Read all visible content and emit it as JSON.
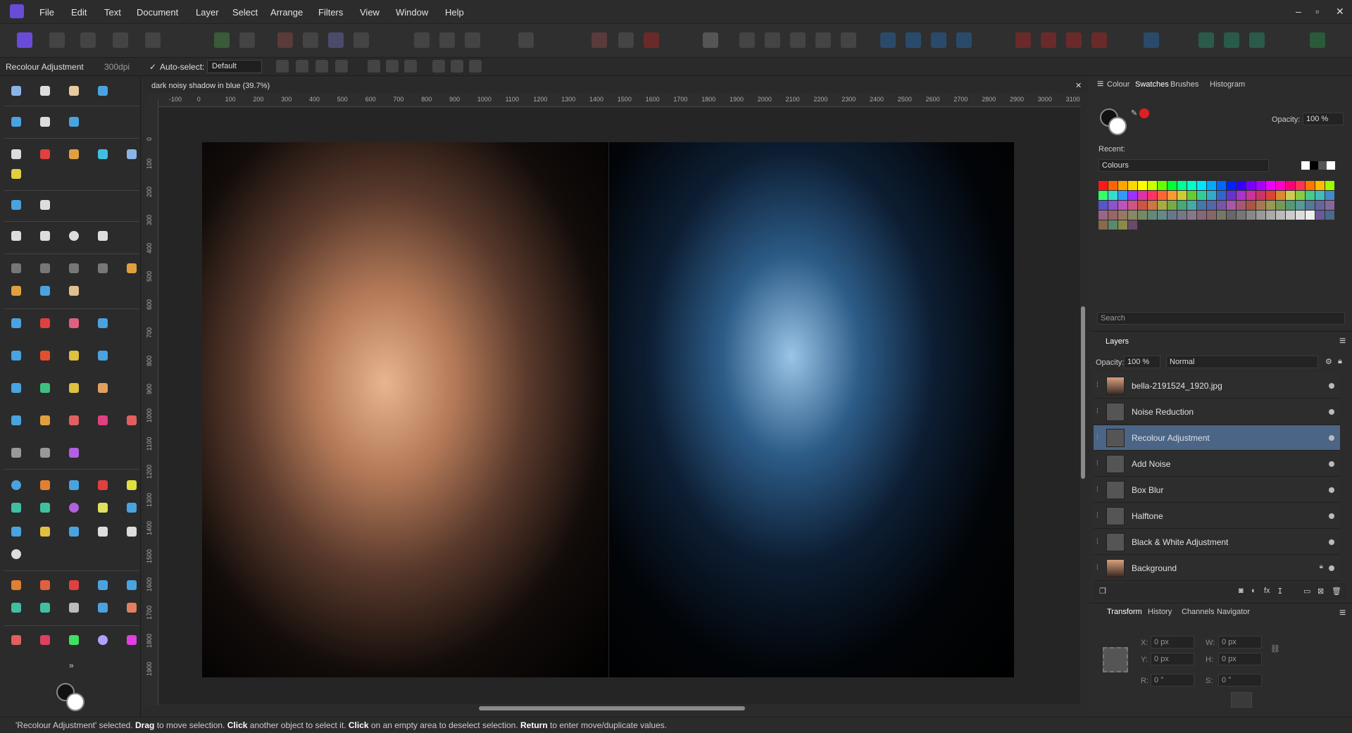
{
  "menubar": {
    "items": [
      "File",
      "Edit",
      "Text",
      "Document",
      "Layer",
      "Select",
      "Arrange",
      "Filters",
      "View",
      "Window",
      "Help"
    ],
    "window_controls": [
      "–",
      "▫",
      "✕"
    ]
  },
  "context": {
    "tool_name": "Recolour Adjustment",
    "dpi": "300dpi",
    "auto_select_label": "Auto-select:",
    "auto_select_value": "Default"
  },
  "document": {
    "tab_title": "dark noisy shadow in blue (39.7%)",
    "close": "✕",
    "ruler_unit": "px",
    "ruler_h_labels": [
      "-100",
      "0",
      "100",
      "200",
      "300",
      "400",
      "500",
      "600",
      "700",
      "800",
      "900",
      "1000",
      "1100",
      "1200",
      "1300",
      "1400",
      "1500",
      "1600",
      "1700",
      "1800",
      "1900",
      "2000",
      "2100",
      "2200",
      "2300",
      "2400",
      "2500",
      "2600",
      "2700",
      "2800",
      "2900",
      "3000",
      "3100"
    ],
    "ruler_v_labels": [
      "0",
      "100",
      "200",
      "300",
      "400",
      "500",
      "600",
      "700",
      "800",
      "900",
      "1000",
      "1100",
      "1200",
      "1300",
      "1400",
      "1500",
      "1600",
      "1700",
      "1800",
      "1900"
    ]
  },
  "colour_panel": {
    "tabs": [
      "Colour",
      "Swatches",
      "Brushes",
      "Histogram"
    ],
    "active_tab": "Swatches",
    "opacity_label": "Opacity:",
    "opacity_value": "100 %",
    "recent_label": "Recent:",
    "palette_name": "Colours",
    "search_placeholder": "Search",
    "swatches": [
      "#ff1a1a",
      "#ff6600",
      "#ffa500",
      "#ffd700",
      "#ffff00",
      "#c8ff00",
      "#66ff00",
      "#00ff33",
      "#00ff99",
      "#00ffcc",
      "#00e6ff",
      "#00aaff",
      "#0066ff",
      "#0022ff",
      "#3300ff",
      "#7700ff",
      "#aa00ff",
      "#ee00ff",
      "#ff00cc",
      "#ff0077",
      "#ff3355",
      "#ff7700",
      "#ffbb00",
      "#99ff00",
      "#33ff66",
      "#33ddcc",
      "#3399ff",
      "#9933ff",
      "#dd33aa",
      "#ff3366",
      "#ff6633",
      "#ff9933",
      "#cccc33",
      "#66cc33",
      "#33cc99",
      "#33aacc",
      "#3366cc",
      "#6633cc",
      "#aa33cc",
      "#cc3399",
      "#cc3366",
      "#dd4433",
      "#dd8833",
      "#cccc55",
      "#88cc44",
      "#44cc88",
      "#44bbbb",
      "#4488cc",
      "#5555cc",
      "#8855cc",
      "#bb55bb",
      "#cc5588",
      "#cc5544",
      "#cc7744",
      "#aaaa44",
      "#77aa44",
      "#44aa77",
      "#44aaaa",
      "#4477aa",
      "#5566aa",
      "#7755aa",
      "#aa55aa",
      "#aa5577",
      "#aa5544",
      "#aa7755",
      "#999955",
      "#779955",
      "#559977",
      "#559999",
      "#557799",
      "#666699",
      "#886699",
      "#996688",
      "#996666",
      "#997766",
      "#888866",
      "#778866",
      "#668877",
      "#668888",
      "#667788",
      "#777788",
      "#887788",
      "#886677",
      "#886666",
      "#777766",
      "#666666",
      "#777777",
      "#888888",
      "#999999",
      "#aaaaaa",
      "#bbbbbb",
      "#cccccc",
      "#dddddd",
      "#eeeeee",
      "#6a5a9a",
      "#4a6a8a",
      "#8a6a4a",
      "#5a8a6a",
      "#8a8a4a",
      "#6a4a6a"
    ]
  },
  "layers_panel": {
    "title": "Layers",
    "opacity_label": "Opacity:",
    "opacity_value": "100 %",
    "blend_mode": "Normal",
    "layers": [
      {
        "name": "bella-2191524_1920.jpg",
        "selected": false
      },
      {
        "name": "Noise Reduction",
        "selected": false
      },
      {
        "name": "Recolour Adjustment",
        "selected": true
      },
      {
        "name": "Add Noise",
        "selected": false
      },
      {
        "name": "Box Blur",
        "selected": false
      },
      {
        "name": "Halftone",
        "selected": false
      },
      {
        "name": "Black & White Adjustment",
        "selected": false
      },
      {
        "name": "Background",
        "selected": false
      }
    ]
  },
  "transform_panel": {
    "tabs": [
      "Transform",
      "History",
      "Channels",
      "Navigator"
    ],
    "active_tab": "Transform",
    "x_label": "X:",
    "x_value": "0 px",
    "y_label": "Y:",
    "y_value": "0 px",
    "w_label": "W:",
    "w_value": "0 px",
    "h_label": "H:",
    "h_value": "0 px",
    "r_label": "R:",
    "r_value": "0 °",
    "s_label": "S:",
    "s_value": "0 °"
  },
  "status": {
    "segments": [
      {
        "text": "'Recolour Adjustment' selected. ",
        "bold": false
      },
      {
        "text": "Drag",
        "bold": true
      },
      {
        "text": " to move selection. ",
        "bold": false
      },
      {
        "text": "Click",
        "bold": true
      },
      {
        "text": " another object to select it. ",
        "bold": false
      },
      {
        "text": "Click",
        "bold": true
      },
      {
        "text": " on an empty area to deselect selection. ",
        "bold": false
      },
      {
        "text": "Return",
        "bold": true
      },
      {
        "text": " to enter move/duplicate values.",
        "bold": false
      }
    ]
  },
  "tool_colors": {
    "accent": "#4aa3df",
    "primary": "#e04040",
    "fill": "#3ab0c8"
  }
}
